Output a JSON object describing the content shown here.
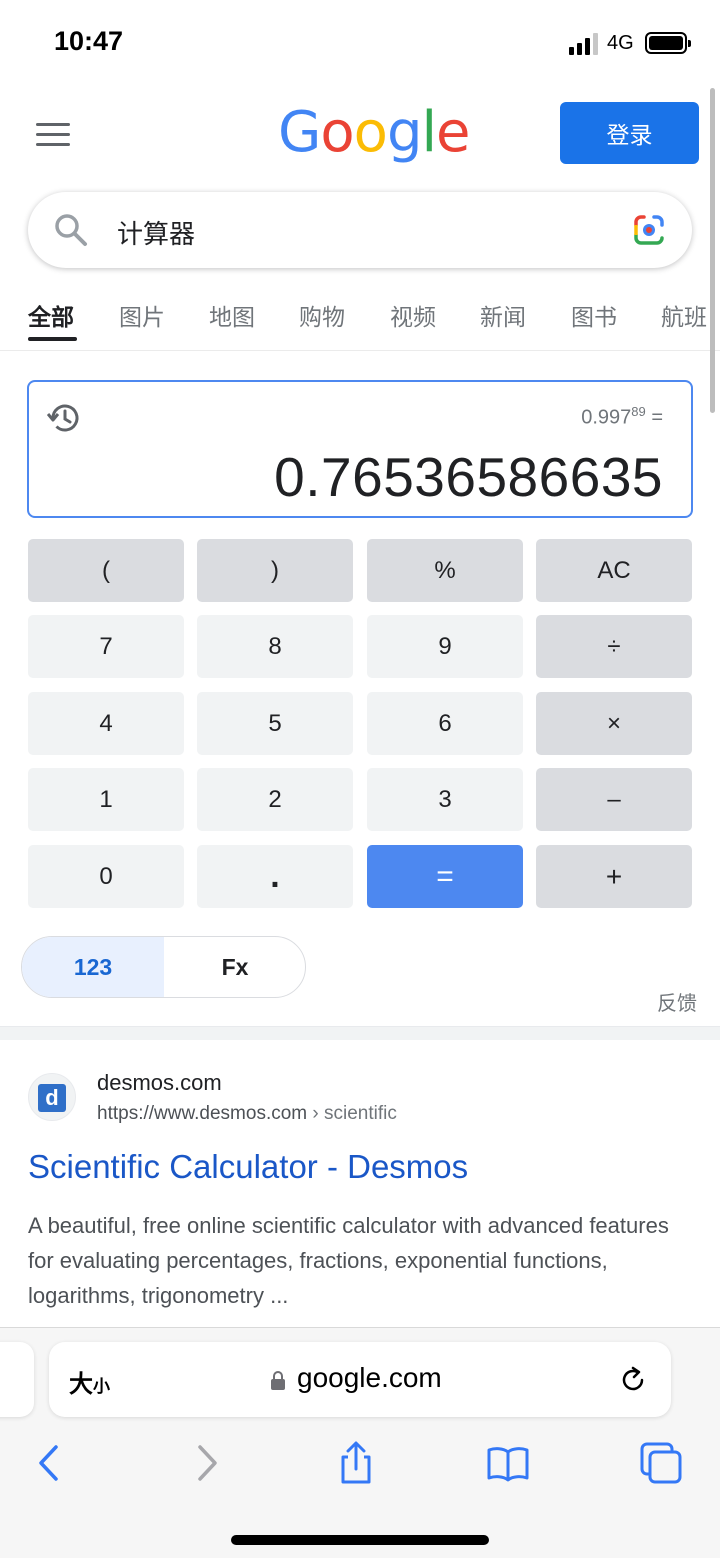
{
  "status_bar": {
    "time": "10:47",
    "network": "4G"
  },
  "header": {
    "logo_text": [
      "G",
      "o",
      "o",
      "g",
      "l",
      "e"
    ],
    "login_label": "登录"
  },
  "search": {
    "query": "计算器"
  },
  "tabs": [
    "全部",
    "图片",
    "地图",
    "购物",
    "视频",
    "新闻",
    "图书",
    "航班"
  ],
  "calculator": {
    "expression_base": "0.997",
    "expression_exponent": "89",
    "expression_equals": "=",
    "result": "0.76536586635",
    "keys": [
      [
        "(",
        ")",
        "%",
        "AC"
      ],
      [
        "7",
        "8",
        "9",
        "÷"
      ],
      [
        "4",
        "5",
        "6",
        "×"
      ],
      [
        "1",
        "2",
        "3",
        "–"
      ],
      [
        "0",
        ".",
        "=",
        "+"
      ]
    ],
    "modes": [
      "123",
      "Fx"
    ],
    "feedback": "反馈"
  },
  "result": {
    "favicon_letter": "d",
    "site_name": "desmos.com",
    "url": "https://www.desmos.com",
    "url_crumb": " › scientific",
    "title": "Scientific Calculator - Desmos",
    "snippet": "A beautiful, free online scientific calculator with advanced features for evaluating percentages, fractions, exponential functions, logarithms, trigonometry ..."
  },
  "browser": {
    "text_size_big": "大",
    "text_size_small": "小",
    "domain": "google.com"
  },
  "colors": {
    "accent": "#1a73e8",
    "equals_key": "#4d88f0",
    "link": "#1a57c7"
  }
}
